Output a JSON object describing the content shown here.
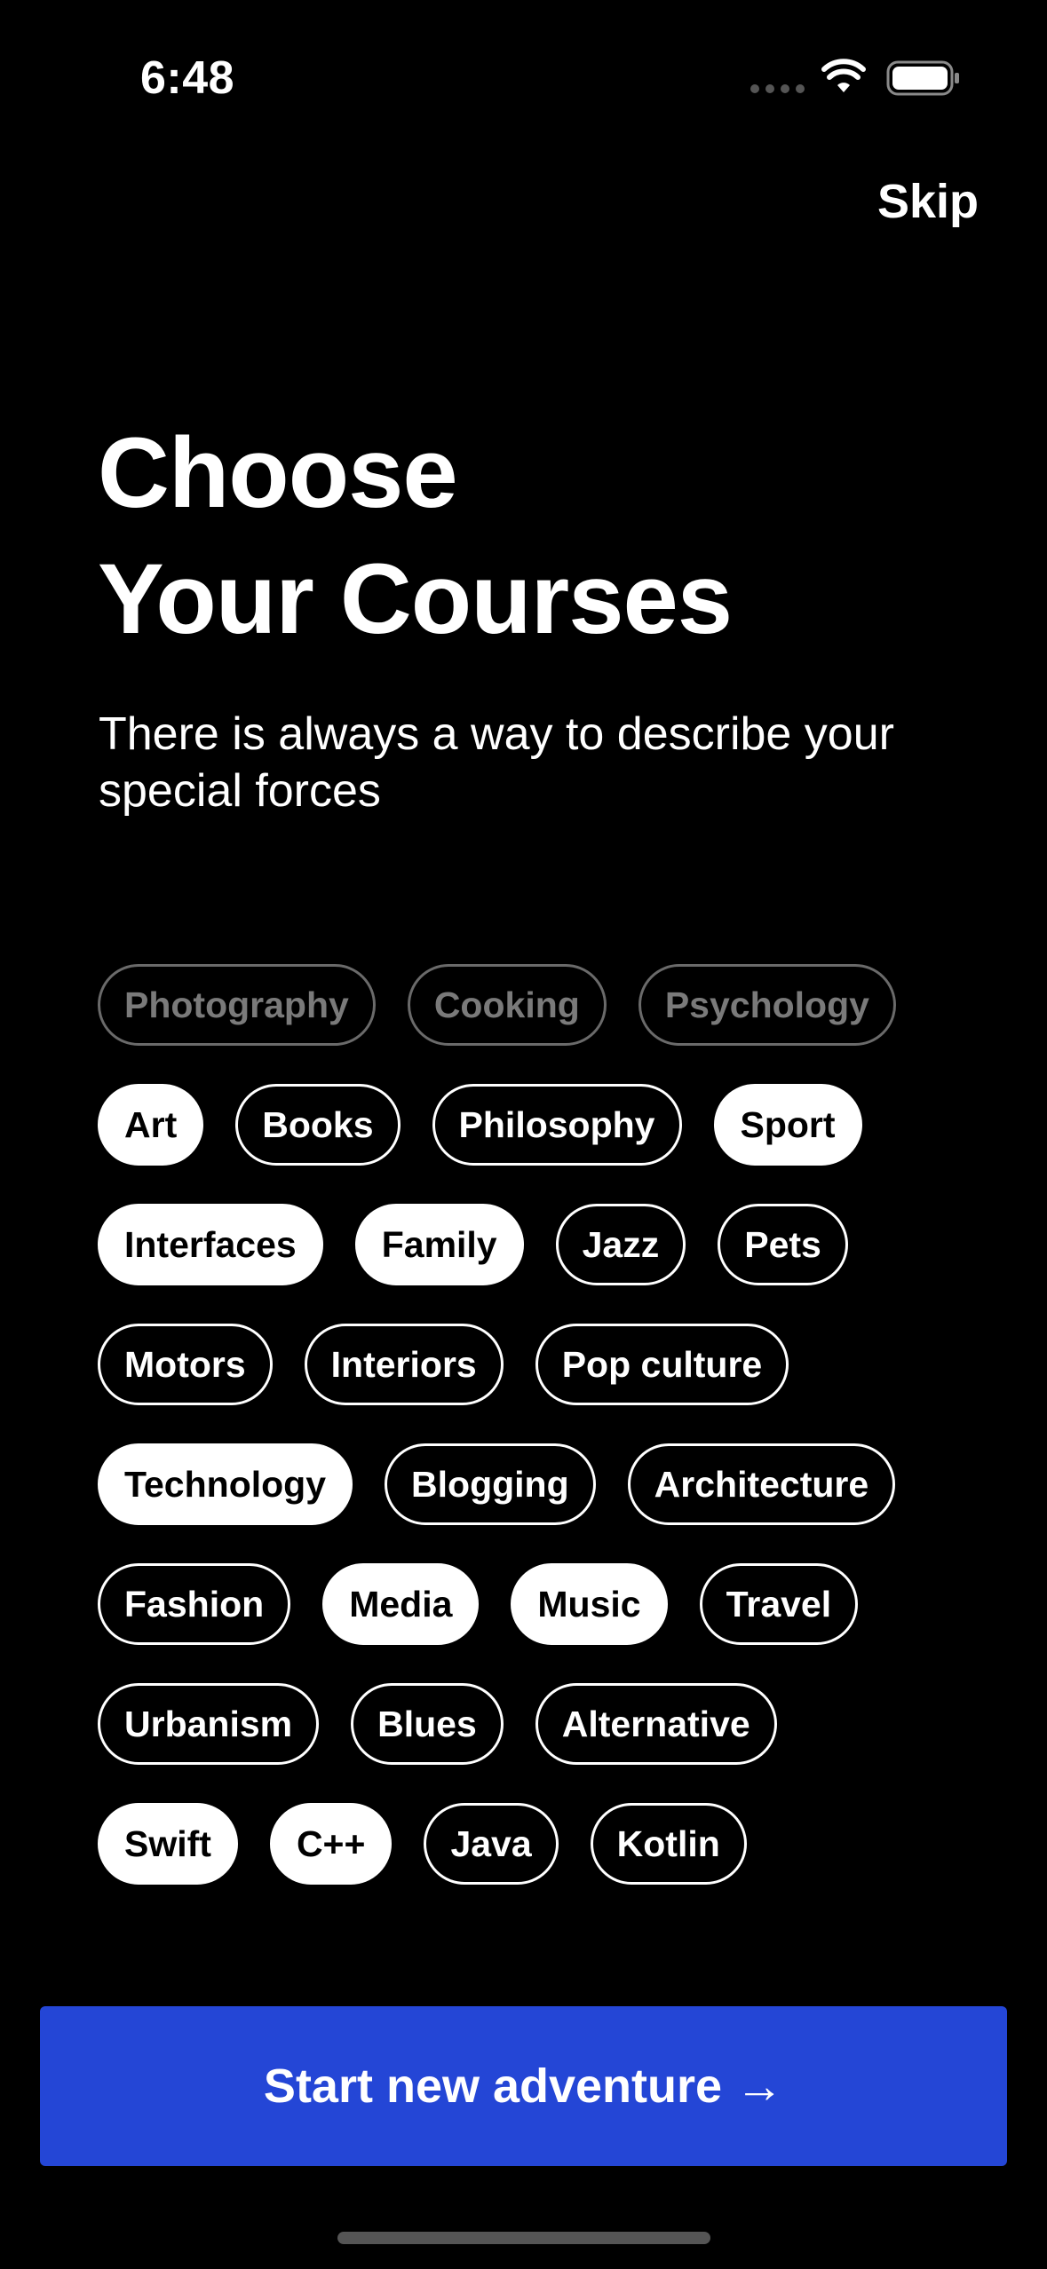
{
  "status_bar": {
    "time": "6:48",
    "icons": [
      "signal-dots-icon",
      "wifi-icon",
      "battery-icon"
    ]
  },
  "header": {
    "skip_label": "Skip"
  },
  "title": {
    "line1": "Choose",
    "line2": "Your Courses"
  },
  "subtitle": "There is always a way to describe your special forces",
  "chip_rows": [
    [
      {
        "label": "Photography",
        "state": "muted"
      },
      {
        "label": "Cooking",
        "state": "muted"
      },
      {
        "label": "Psychology",
        "state": "muted"
      }
    ],
    [
      {
        "label": "Art",
        "state": "selected"
      },
      {
        "label": "Books",
        "state": "outline"
      },
      {
        "label": "Philosophy",
        "state": "outline"
      },
      {
        "label": "Sport",
        "state": "selected"
      }
    ],
    [
      {
        "label": "Interfaces",
        "state": "selected"
      },
      {
        "label": "Family",
        "state": "selected"
      },
      {
        "label": "Jazz",
        "state": "outline"
      },
      {
        "label": "Pets",
        "state": "outline"
      }
    ],
    [
      {
        "label": "Motors",
        "state": "outline"
      },
      {
        "label": "Interiors",
        "state": "outline"
      },
      {
        "label": "Pop culture",
        "state": "outline"
      }
    ],
    [
      {
        "label": "Technology",
        "state": "selected"
      },
      {
        "label": "Blogging",
        "state": "outline"
      },
      {
        "label": "Architecture",
        "state": "outline"
      }
    ],
    [
      {
        "label": "Fashion",
        "state": "outline"
      },
      {
        "label": "Media",
        "state": "selected"
      },
      {
        "label": "Music",
        "state": "selected"
      },
      {
        "label": "Travel",
        "state": "outline"
      }
    ],
    [
      {
        "label": "Urbanism",
        "state": "outline"
      },
      {
        "label": "Blues",
        "state": "outline"
      },
      {
        "label": "Alternative",
        "state": "outline"
      }
    ],
    [
      {
        "label": "Swift",
        "state": "selected"
      },
      {
        "label": "C++",
        "state": "selected"
      },
      {
        "label": "Java",
        "state": "outline"
      },
      {
        "label": "Kotlin",
        "state": "outline"
      }
    ]
  ],
  "cta": {
    "label": "Start new adventure →"
  },
  "colors": {
    "background": "#000000",
    "accent": "#2446d6",
    "chip_selected_bg": "#ffffff",
    "chip_muted_text": "#7a7a7a"
  }
}
